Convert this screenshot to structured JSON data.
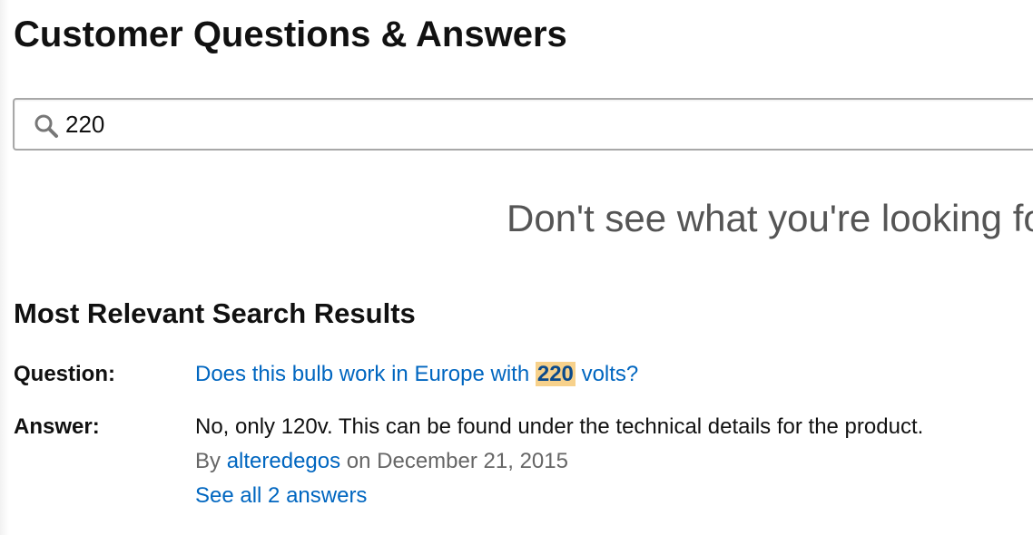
{
  "page": {
    "title": "Customer Questions & Answers"
  },
  "search": {
    "value": "220",
    "icon": "search-icon"
  },
  "prompt": {
    "text": "Don't see what you're looking fo"
  },
  "results": {
    "heading": "Most Relevant Search Results",
    "items": [
      {
        "question_label": "Question:",
        "question_before": "Does this bulb work in Europe with ",
        "question_highlight": "220",
        "question_after": " volts?",
        "answer_label": "Answer:",
        "answer_text": "No, only 120v. This can be found under the technical details for the product.",
        "byline_prefix": "By ",
        "author": "alteredegos",
        "byline_suffix": " on December 21, 2015",
        "see_all": "See all 2 answers"
      }
    ]
  },
  "colors": {
    "link": "#0066c0",
    "highlight": "#f7d18b",
    "heading": "#111111",
    "muted": "#666666"
  }
}
